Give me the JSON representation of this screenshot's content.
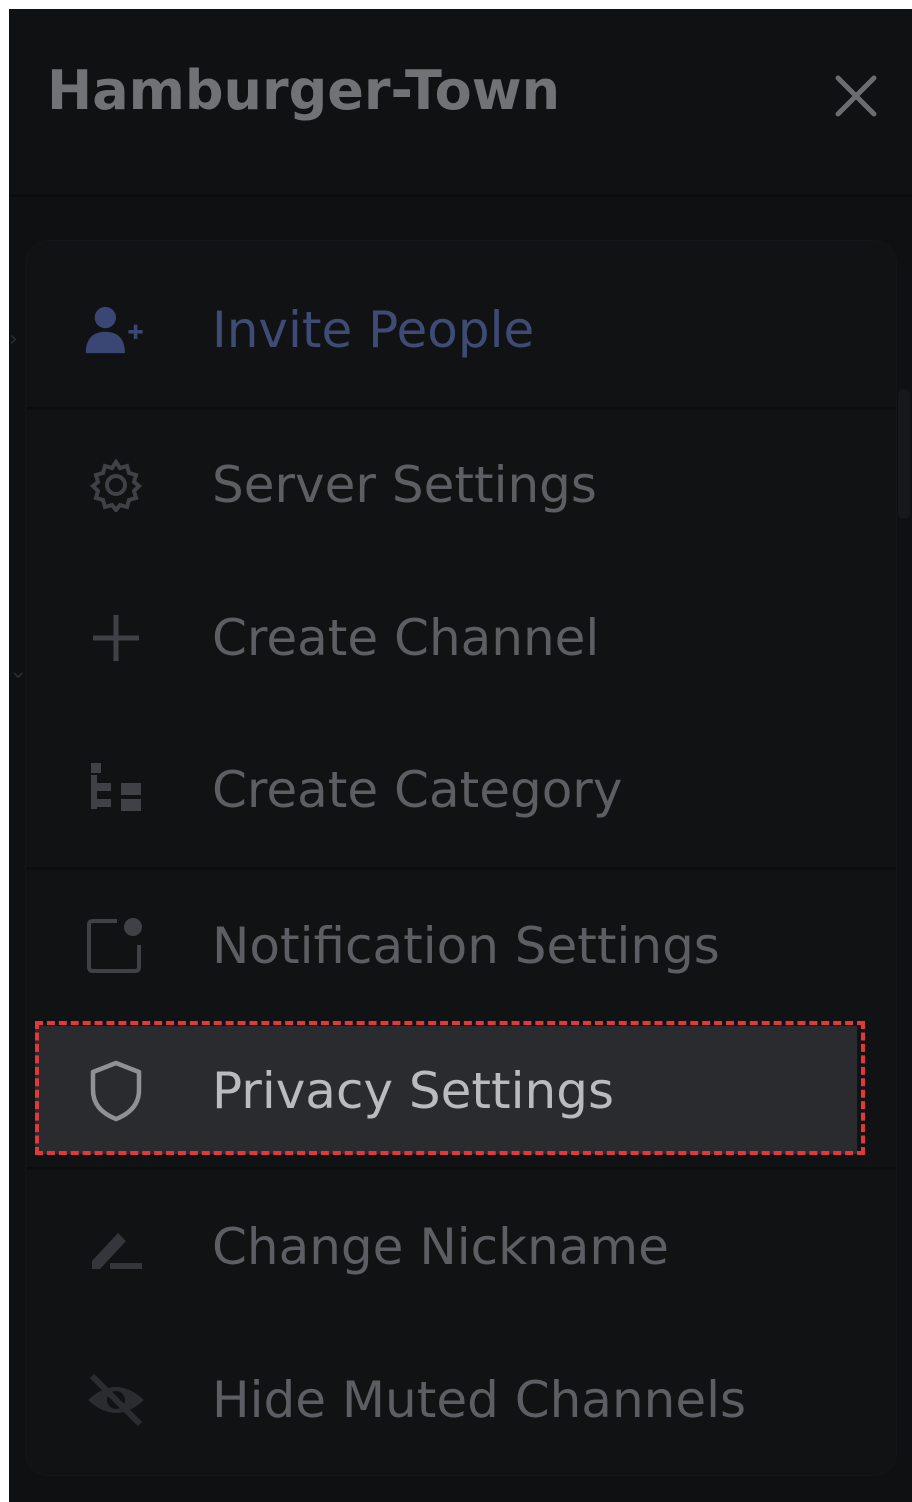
{
  "header": {
    "server_name": "Hamburger-Town",
    "close_icon": "close-icon"
  },
  "menu": {
    "items": [
      {
        "label": "Invite People",
        "icon": "add-person-icon",
        "color": "#3e4b75"
      },
      {
        "label": "Server Settings",
        "icon": "gear-icon"
      },
      {
        "label": "Create Channel",
        "icon": "plus-icon"
      },
      {
        "label": "Create Category",
        "icon": "category-icon"
      },
      {
        "label": "Notification Settings",
        "icon": "notification-icon"
      },
      {
        "label": "Privacy Settings",
        "icon": "shield-icon",
        "highlighted": true
      },
      {
        "label": "Change Nickname",
        "icon": "pencil-icon"
      },
      {
        "label": "Hide Muted Channels",
        "icon": "eye-slash-icon"
      }
    ]
  },
  "annotation": {
    "highlight_color": "#e0383b",
    "highlighted_item": "Privacy Settings"
  }
}
